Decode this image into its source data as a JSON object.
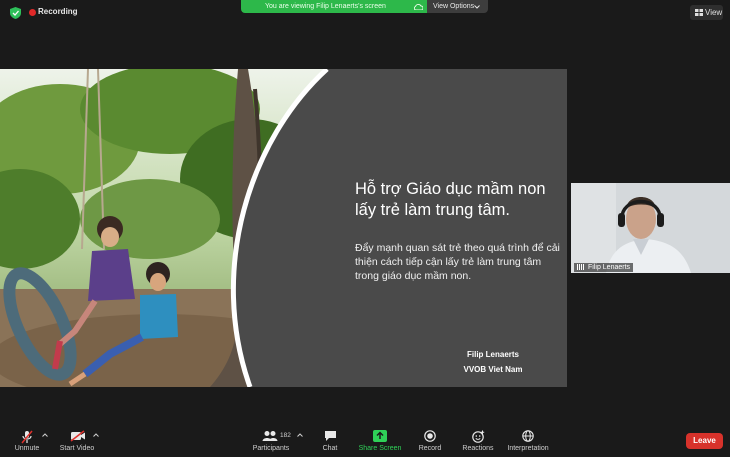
{
  "topbar": {
    "recording_label": "Recording",
    "viewing_banner": "You are viewing Filip Lenaerts's screen",
    "view_options_label": "View Options",
    "view_button_label": "View"
  },
  "slide": {
    "title": "Hỗ trợ Giáo dục mầm non lấy trẻ làm trung tâm.",
    "body": "Đẩy mạnh quan sát trẻ theo quá trình để cải thiện cách tiếp cận lấy trẻ làm trung tâm trong giáo dục mầm non.",
    "presenter": "Filip Lenaerts",
    "organization": "VVOB Viet Nam"
  },
  "participant_tile": {
    "name": "Filip Lenaerts"
  },
  "toolbar": {
    "unmute": "Unmute",
    "start_video": "Start Video",
    "participants": "Participants",
    "participants_count": "182",
    "chat": "Chat",
    "share_screen": "Share Screen",
    "record": "Record",
    "reactions": "Reactions",
    "interpretation": "Interpretation",
    "leave": "Leave"
  },
  "icons": {
    "security": "shield-icon",
    "recording": "recording-dot-icon",
    "cloud": "cloud-icon",
    "view": "grid-view-icon",
    "unmute": "microphone-muted-icon",
    "start_video": "video-camera-off-icon",
    "participants": "people-icon",
    "chat": "chat-bubble-icon",
    "share_screen": "share-arrow-icon",
    "record": "record-icon",
    "reactions": "emoji-plus-icon",
    "interpretation": "globe-icon"
  },
  "colors": {
    "accent_green": "#2db84a",
    "share_green": "#2fd158",
    "recording_red": "#e02828",
    "leave_red": "#d7322b",
    "slide_panel": "#4a4a4a"
  }
}
